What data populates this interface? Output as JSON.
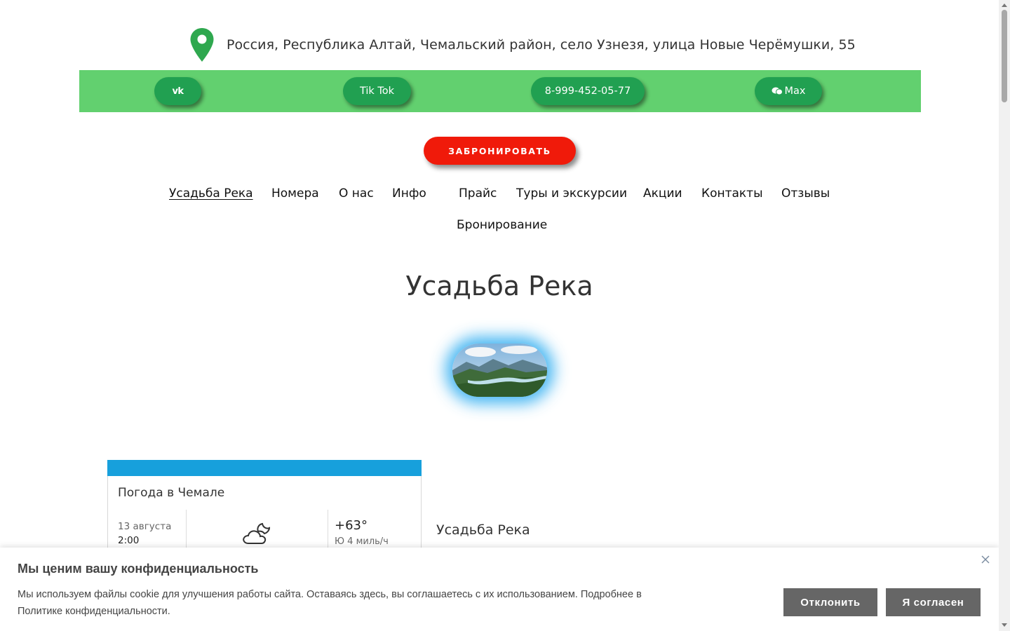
{
  "header": {
    "address": "Россия, Республика Алтай, Чемальский район, село Узнезя, улица Новые Черёмушки, 55",
    "icon": "map-pin-icon",
    "pin_color": "#2fa84f"
  },
  "social_bar": {
    "background": "#62d06f",
    "vk_label": "vk",
    "tiktok_label": "Tik Tok",
    "phone_label": "8-999-452-05-77",
    "max_label": "Max"
  },
  "booking": {
    "label": "ЗАБРОНИРОВАТЬ",
    "color": "#f01a0a"
  },
  "nav": {
    "items": [
      "Усадьба Река",
      "Номера",
      "О нас",
      "Инфо",
      "Прайс",
      "Туры и экскурсии",
      "Акции",
      "Контакты",
      "Отзывы",
      "Бронирование"
    ],
    "active": "Усадьба Река"
  },
  "main": {
    "title": "Усадьба Река"
  },
  "weather": {
    "title": "Погода в Чемале",
    "date": "13 августа",
    "time": "2:00",
    "icon": "partly-cloudy-night-icon",
    "temperature": "+63°",
    "wind": "Ю 4 миль/ч",
    "accent": "#17a0dc"
  },
  "side": {
    "title": "Усадьба Река"
  },
  "cookie": {
    "title": "Мы ценим вашу конфиденциальность",
    "text": "Мы используем файлы cookie для улучшения работы сайта. Оставаясь здесь, вы соглашаетесь с их использованием. Подробнее в Политике конфиденциальности.",
    "decline_label": "Отклонить",
    "accept_label": "Я согласен"
  }
}
